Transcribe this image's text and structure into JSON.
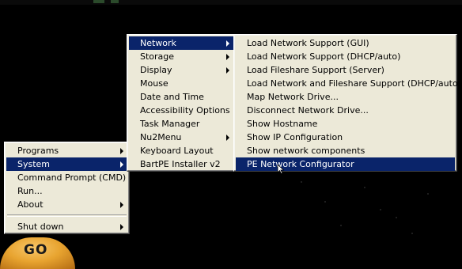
{
  "start_menu": {
    "items": [
      {
        "label": "Programs",
        "has_submenu": true,
        "selected": false
      },
      {
        "label": "System",
        "has_submenu": true,
        "selected": true
      },
      {
        "label": "Command Prompt (CMD)",
        "has_submenu": false,
        "selected": false
      },
      {
        "label": "Run...",
        "has_submenu": false,
        "selected": false
      },
      {
        "label": "About",
        "has_submenu": true,
        "selected": false
      }
    ],
    "shutdown_label": "Shut down"
  },
  "system_menu": {
    "items": [
      {
        "label": "Network",
        "has_submenu": true,
        "selected": true
      },
      {
        "label": "Storage",
        "has_submenu": true,
        "selected": false
      },
      {
        "label": "Display",
        "has_submenu": true,
        "selected": false
      },
      {
        "label": "Mouse",
        "has_submenu": false,
        "selected": false
      },
      {
        "label": "Date and Time",
        "has_submenu": false,
        "selected": false
      },
      {
        "label": "Accessibility Options",
        "has_submenu": false,
        "selected": false
      },
      {
        "label": "Task Manager",
        "has_submenu": false,
        "selected": false
      },
      {
        "label": "Nu2Menu",
        "has_submenu": true,
        "selected": false
      },
      {
        "label": "Keyboard Layout",
        "has_submenu": false,
        "selected": false
      },
      {
        "label": "BartPE Installer v2",
        "has_submenu": false,
        "selected": false
      }
    ]
  },
  "network_menu": {
    "items": [
      {
        "label": "Load Network Support (GUI)",
        "selected": false
      },
      {
        "label": "Load Network Support (DHCP/auto)",
        "selected": false
      },
      {
        "label": "Load Fileshare Support (Server)",
        "selected": false
      },
      {
        "label": "Load Network and Fileshare Support (DHCP/auto)",
        "selected": false
      },
      {
        "label": "Map Network Drive...",
        "selected": false
      },
      {
        "label": "Disconnect Network Drive...",
        "selected": false
      },
      {
        "label": "Show Hostname",
        "selected": false
      },
      {
        "label": "Show IP Configuration",
        "selected": false
      },
      {
        "label": "Show network components",
        "selected": false
      },
      {
        "label": "PE Network Configurator",
        "selected": true
      }
    ]
  },
  "go_button": {
    "label": "GO"
  },
  "colors": {
    "menu_bg": "#ece9d8",
    "highlight": "#0a246a",
    "desktop": "#000000",
    "go_orange": "#e8a430"
  }
}
